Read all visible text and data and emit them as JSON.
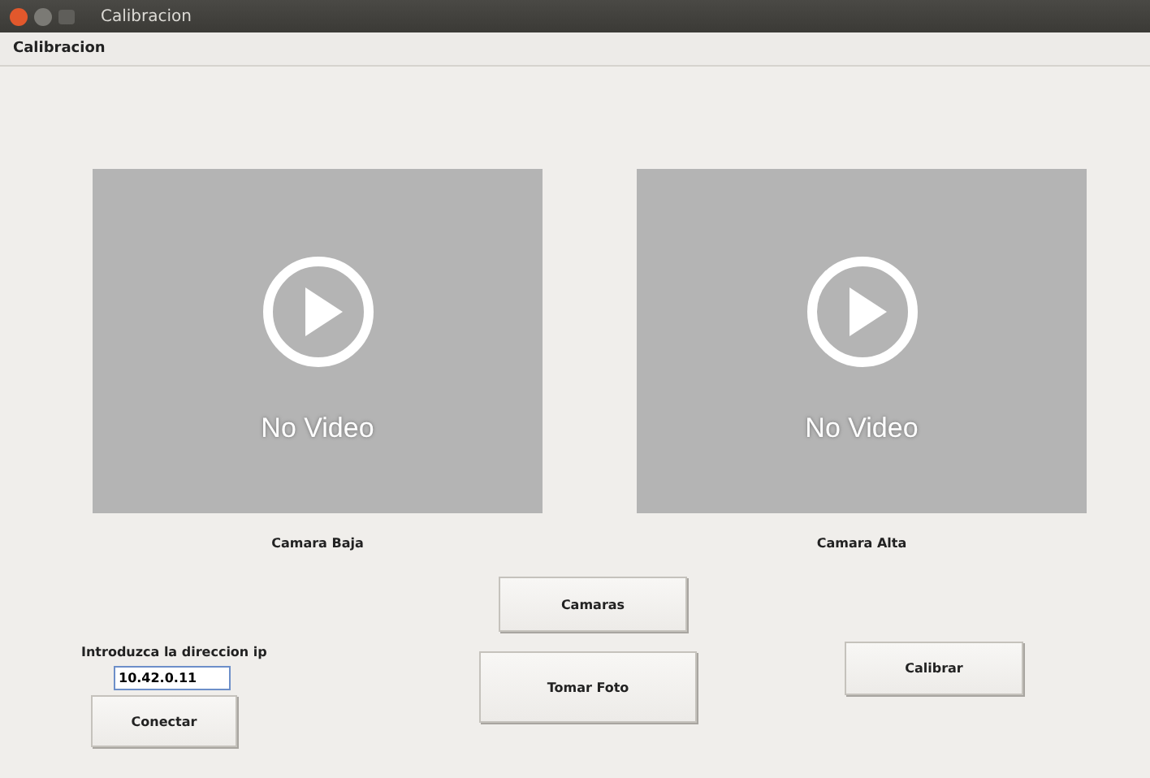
{
  "window": {
    "title": "Calibracion"
  },
  "menu": [
    "Calibracion"
  ],
  "videos": [
    {
      "text": "No Video",
      "label": "Camara Baja"
    },
    {
      "text": "No Video",
      "label": "Camara Alta"
    }
  ],
  "ip": {
    "label": "Introduzca la direccion ip",
    "value": "10.42.0.11"
  },
  "buttons": {
    "connect": "Conectar",
    "cameras": "Camaras",
    "photo": "Tomar Foto",
    "calibrate": "Calibrar"
  }
}
